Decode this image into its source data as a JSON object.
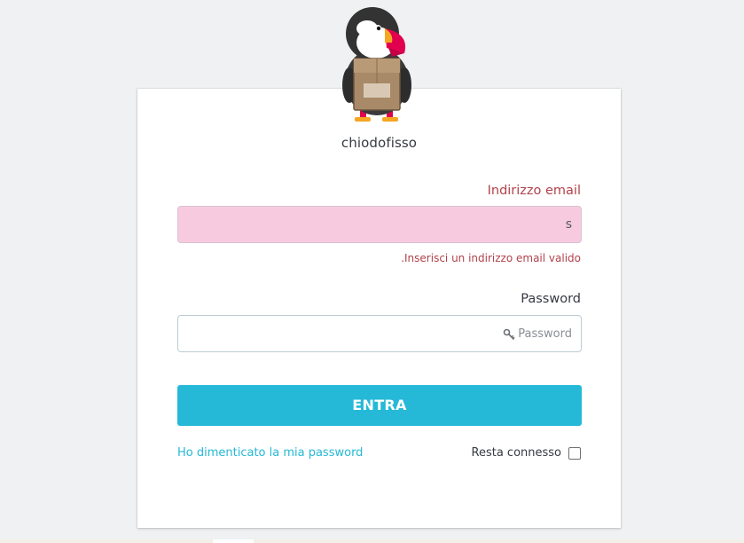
{
  "shop": {
    "name": "chiodofisso",
    "logo_icon": "prestashop-puffin-logo"
  },
  "email": {
    "label": "Indirizzo email",
    "value": "s",
    "error": ".Inserisci un indirizzo email valido",
    "state_color": "#f8cae0"
  },
  "password": {
    "label": "Password",
    "placeholder": "Password",
    "icon": "key-icon"
  },
  "submit": {
    "label": "ENTRA",
    "color": "#25b9d7"
  },
  "links": {
    "forgot": "Ho dimenticato la mia password",
    "stay_logged_in": "Resta connesso"
  },
  "colors": {
    "accent": "#25b9d7",
    "error": "#b2414b",
    "background": "#eff1f2"
  }
}
